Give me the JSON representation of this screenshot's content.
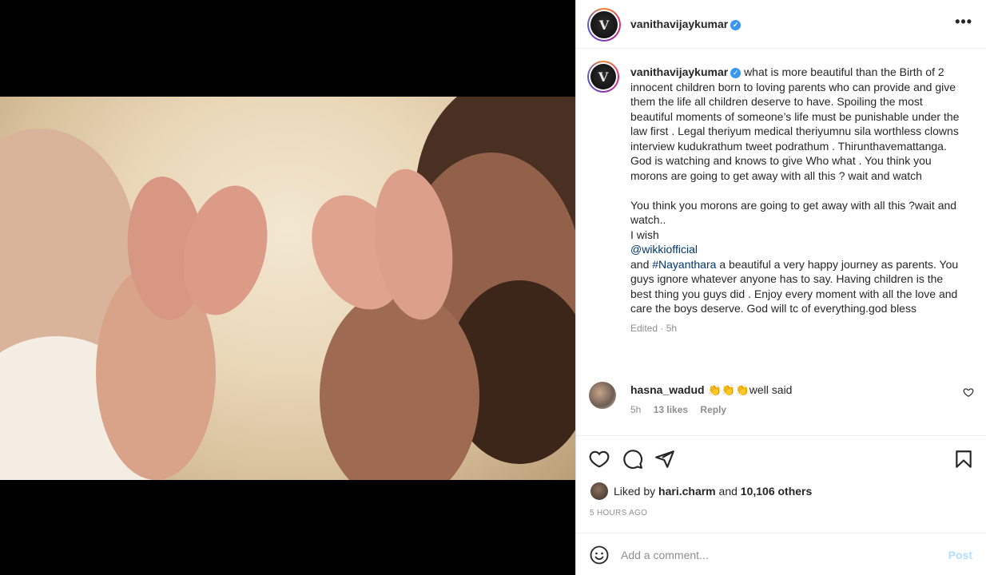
{
  "post": {
    "author": "vanithavijaykumar",
    "avatar_letter": "V",
    "verified_glyph": "✓",
    "more_glyph": "•••"
  },
  "caption": {
    "username": "vanithavijaykumar",
    "lines": [
      "what is more beautiful than the Birth of 2 innocent children born to loving parents who can provide and give them the life all children deserve to have. Spoiling the most beautiful moments of someone’s life must be punishable under the law first . Legal theriyum medical theriyumnu sila worthless clowns interview kudukrathum tweet podrathum . Thirunthavemattanga. God is watching and knows to give Who what . You think you morons are going to get away with all this ? wait and watch",
      "You think you morons are going to get away with all this ?wait and watch..",
      "I wish"
    ],
    "mention": "@wikkiofficial",
    "and_word": "and",
    "hashtag": "#Nayanthara",
    "closing": "a beautiful a very happy journey as parents. You guys ignore whatever anyone has to say. Having children is the best thing you guys did . Enjoy every moment with all the love and care the boys deserve. God will tc of everything.god bless",
    "edited": "Edited · 5h"
  },
  "comment": {
    "username": "hasna_wadud",
    "text": "👏👏👏well said",
    "time": "5h",
    "likes": "13 likes",
    "reply": "Reply"
  },
  "likes": {
    "prefix": "Liked by",
    "user": "hari.charm",
    "mid": "and",
    "count": "10,106 others"
  },
  "time_ago": "5 HOURS AGO",
  "add_comment": {
    "placeholder": "Add a comment...",
    "post_label": "Post"
  },
  "colors": {
    "link": "#00376b",
    "verified": "#3897f0",
    "post_disabled": "#b2dffc"
  },
  "icons": [
    "heart-icon",
    "comment-icon",
    "share-icon",
    "bookmark-icon",
    "emoji-icon",
    "more-icon"
  ]
}
